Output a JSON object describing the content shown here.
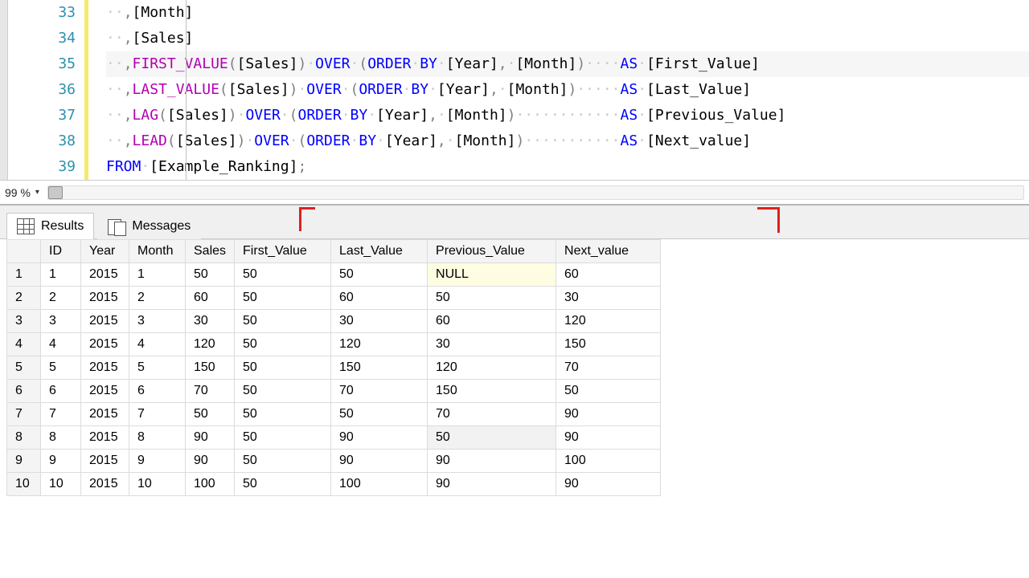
{
  "editor": {
    "lines": [
      {
        "num": 33,
        "segments": [
          {
            "c": "ws",
            "t": "··"
          },
          {
            "c": "gray",
            "t": ","
          },
          {
            "c": "txt",
            "t": "[Month]"
          }
        ]
      },
      {
        "num": 34,
        "segments": [
          {
            "c": "ws",
            "t": "··"
          },
          {
            "c": "gray",
            "t": ","
          },
          {
            "c": "txt",
            "t": "[Sales]"
          }
        ]
      },
      {
        "num": 35,
        "highlight": true,
        "segments": [
          {
            "c": "ws",
            "t": "··"
          },
          {
            "c": "gray",
            "t": ","
          },
          {
            "c": "fn",
            "t": "FIRST_VALUE"
          },
          {
            "c": "gray",
            "t": "("
          },
          {
            "c": "txt",
            "t": "[Sales]"
          },
          {
            "c": "gray",
            "t": ")"
          },
          {
            "c": "ws",
            "t": "·"
          },
          {
            "c": "kw",
            "t": "OVER"
          },
          {
            "c": "ws",
            "t": "·"
          },
          {
            "c": "gray",
            "t": "("
          },
          {
            "c": "kw",
            "t": "ORDER"
          },
          {
            "c": "ws",
            "t": "·"
          },
          {
            "c": "kw",
            "t": "BY"
          },
          {
            "c": "ws",
            "t": "·"
          },
          {
            "c": "txt",
            "t": "[Year]"
          },
          {
            "c": "gray",
            "t": ","
          },
          {
            "c": "ws",
            "t": "·"
          },
          {
            "c": "txt",
            "t": "[Month]"
          },
          {
            "c": "gray",
            "t": ")"
          },
          {
            "c": "ws",
            "t": "····"
          },
          {
            "c": "kw",
            "t": "AS"
          },
          {
            "c": "ws",
            "t": "·"
          },
          {
            "c": "txt",
            "t": "[First_Value]"
          }
        ]
      },
      {
        "num": 36,
        "segments": [
          {
            "c": "ws",
            "t": "··"
          },
          {
            "c": "gray",
            "t": ","
          },
          {
            "c": "fn",
            "t": "LAST_VALUE"
          },
          {
            "c": "gray",
            "t": "("
          },
          {
            "c": "txt",
            "t": "[Sales]"
          },
          {
            "c": "gray",
            "t": ")"
          },
          {
            "c": "ws",
            "t": "·"
          },
          {
            "c": "kw",
            "t": "OVER"
          },
          {
            "c": "ws",
            "t": "·"
          },
          {
            "c": "gray",
            "t": "("
          },
          {
            "c": "kw",
            "t": "ORDER"
          },
          {
            "c": "ws",
            "t": "·"
          },
          {
            "c": "kw",
            "t": "BY"
          },
          {
            "c": "ws",
            "t": "·"
          },
          {
            "c": "txt",
            "t": "[Year]"
          },
          {
            "c": "gray",
            "t": ","
          },
          {
            "c": "ws",
            "t": "·"
          },
          {
            "c": "txt",
            "t": "[Month]"
          },
          {
            "c": "gray",
            "t": ")"
          },
          {
            "c": "ws",
            "t": "·····"
          },
          {
            "c": "kw",
            "t": "AS"
          },
          {
            "c": "ws",
            "t": "·"
          },
          {
            "c": "txt",
            "t": "[Last_Value]"
          }
        ]
      },
      {
        "num": 37,
        "segments": [
          {
            "c": "ws",
            "t": "··"
          },
          {
            "c": "gray",
            "t": ","
          },
          {
            "c": "fn",
            "t": "LAG"
          },
          {
            "c": "gray",
            "t": "("
          },
          {
            "c": "txt",
            "t": "[Sales]"
          },
          {
            "c": "gray",
            "t": ")"
          },
          {
            "c": "ws",
            "t": "·"
          },
          {
            "c": "kw",
            "t": "OVER"
          },
          {
            "c": "ws",
            "t": "·"
          },
          {
            "c": "gray",
            "t": "("
          },
          {
            "c": "kw",
            "t": "ORDER"
          },
          {
            "c": "ws",
            "t": "·"
          },
          {
            "c": "kw",
            "t": "BY"
          },
          {
            "c": "ws",
            "t": "·"
          },
          {
            "c": "txt",
            "t": "[Year]"
          },
          {
            "c": "gray",
            "t": ","
          },
          {
            "c": "ws",
            "t": "·"
          },
          {
            "c": "txt",
            "t": "[Month]"
          },
          {
            "c": "gray",
            "t": ")"
          },
          {
            "c": "ws",
            "t": "············"
          },
          {
            "c": "kw",
            "t": "AS"
          },
          {
            "c": "ws",
            "t": "·"
          },
          {
            "c": "txt",
            "t": "[Previous_Value]"
          }
        ]
      },
      {
        "num": 38,
        "segments": [
          {
            "c": "ws",
            "t": "··"
          },
          {
            "c": "gray",
            "t": ","
          },
          {
            "c": "fn",
            "t": "LEAD"
          },
          {
            "c": "gray",
            "t": "("
          },
          {
            "c": "txt",
            "t": "[Sales]"
          },
          {
            "c": "gray",
            "t": ")"
          },
          {
            "c": "ws",
            "t": "·"
          },
          {
            "c": "kw",
            "t": "OVER"
          },
          {
            "c": "ws",
            "t": "·"
          },
          {
            "c": "gray",
            "t": "("
          },
          {
            "c": "kw",
            "t": "ORDER"
          },
          {
            "c": "ws",
            "t": "·"
          },
          {
            "c": "kw",
            "t": "BY"
          },
          {
            "c": "ws",
            "t": "·"
          },
          {
            "c": "txt",
            "t": "[Year]"
          },
          {
            "c": "gray",
            "t": ","
          },
          {
            "c": "ws",
            "t": "·"
          },
          {
            "c": "txt",
            "t": "[Month]"
          },
          {
            "c": "gray",
            "t": ")"
          },
          {
            "c": "ws",
            "t": "···········"
          },
          {
            "c": "kw",
            "t": "AS"
          },
          {
            "c": "ws",
            "t": "·"
          },
          {
            "c": "txt",
            "t": "[Next_value]"
          }
        ]
      },
      {
        "num": 39,
        "segments": [
          {
            "c": "kw",
            "t": "FROM"
          },
          {
            "c": "ws",
            "t": "·"
          },
          {
            "c": "txt",
            "t": "[Example_Ranking]"
          },
          {
            "c": "gray",
            "t": ";"
          }
        ]
      }
    ]
  },
  "zoom": {
    "value": "99 %"
  },
  "tabs": {
    "results": "Results",
    "messages": "Messages"
  },
  "grid": {
    "headers": [
      "ID",
      "Year",
      "Month",
      "Sales",
      "First_Value",
      "Last_Value",
      "Previous_Value",
      "Next_value"
    ],
    "rows": [
      {
        "n": "1",
        "cells": [
          "1",
          "2015",
          "1",
          "50",
          "50",
          "50",
          "NULL",
          "60"
        ],
        "null": 6
      },
      {
        "n": "2",
        "cells": [
          "2",
          "2015",
          "2",
          "60",
          "50",
          "60",
          "50",
          "30"
        ]
      },
      {
        "n": "3",
        "cells": [
          "3",
          "2015",
          "3",
          "30",
          "50",
          "30",
          "60",
          "120"
        ]
      },
      {
        "n": "4",
        "cells": [
          "4",
          "2015",
          "4",
          "120",
          "50",
          "120",
          "30",
          "150"
        ]
      },
      {
        "n": "5",
        "cells": [
          "5",
          "2015",
          "5",
          "150",
          "50",
          "150",
          "120",
          "70"
        ]
      },
      {
        "n": "6",
        "cells": [
          "6",
          "2015",
          "6",
          "70",
          "50",
          "70",
          "150",
          "50"
        ]
      },
      {
        "n": "7",
        "cells": [
          "7",
          "2015",
          "7",
          "50",
          "50",
          "50",
          "70",
          "90"
        ]
      },
      {
        "n": "8",
        "cells": [
          "8",
          "2015",
          "8",
          "90",
          "50",
          "90",
          "50",
          "90"
        ],
        "sel": 6
      },
      {
        "n": "9",
        "cells": [
          "9",
          "2015",
          "9",
          "90",
          "50",
          "90",
          "90",
          "100"
        ]
      },
      {
        "n": "10",
        "cells": [
          "10",
          "2015",
          "10",
          "100",
          "50",
          "100",
          "90",
          "90"
        ]
      }
    ]
  }
}
